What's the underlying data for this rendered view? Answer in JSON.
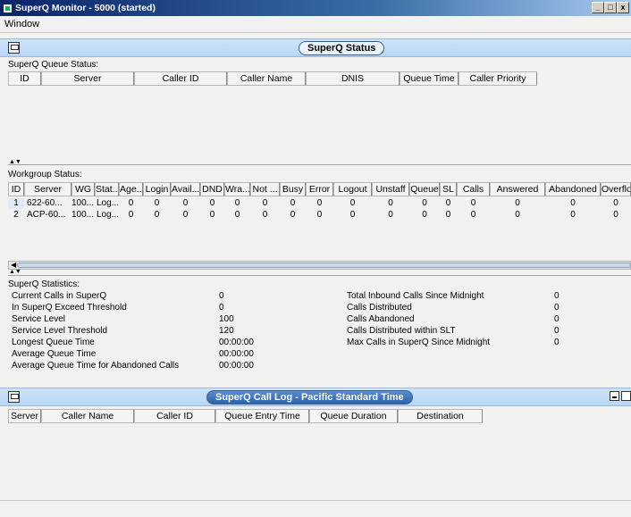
{
  "window": {
    "title": "SuperQ Monitor - 5000 (started)",
    "buttons": {
      "minimize": "_",
      "maximize": "□",
      "close": "x"
    }
  },
  "menu": {
    "items": [
      {
        "label": "Window"
      }
    ]
  },
  "status_panel": {
    "title": "SuperQ Status"
  },
  "queue_status": {
    "label": "SuperQ Queue Status:",
    "columns": [
      "ID",
      "Server",
      "Caller ID",
      "Caller Name",
      "DNIS",
      "Queue Time",
      "Caller Priority"
    ]
  },
  "workgroup_status": {
    "label": "Workgroup Status:",
    "columns": [
      "ID",
      "Server",
      "WG",
      "Stat...",
      "Age...",
      "Login",
      "Avail...",
      "DND",
      "Wra...",
      "Not ...",
      "Busy",
      "Error",
      "Logout",
      "Unstaff",
      "Queue",
      "SL",
      "Calls",
      "Answered",
      "Abandoned",
      "Overflo"
    ],
    "rows": [
      [
        "1",
        "622-60...",
        "100...",
        "Log...",
        "0",
        "0",
        "0",
        "0",
        "0",
        "0",
        "0",
        "0",
        "0",
        "0",
        "0",
        "0",
        "0",
        "0",
        "0",
        "0"
      ],
      [
        "2",
        "ACP-60...",
        "100...",
        "Log...",
        "0",
        "0",
        "0",
        "0",
        "0",
        "0",
        "0",
        "0",
        "0",
        "0",
        "0",
        "0",
        "0",
        "0",
        "0",
        "0"
      ]
    ]
  },
  "statistics": {
    "label": "SuperQ Statistics:",
    "left": [
      {
        "label": "Current Calls in SuperQ",
        "value": "0"
      },
      {
        "label": "In SuperQ Exceed Threshold",
        "value": "0"
      },
      {
        "label": "Service Level",
        "value": "100"
      },
      {
        "label": "Service Level Threshold",
        "value": "120"
      },
      {
        "label": "Longest Queue Time",
        "value": "00:00:00"
      },
      {
        "label": "Average Queue Time",
        "value": "00:00:00"
      },
      {
        "label": "Average Queue Time for Abandoned Calls",
        "value": "00:00:00"
      }
    ],
    "right": [
      {
        "label": "Total Inbound Calls Since Midnight",
        "value": "0"
      },
      {
        "label": "Calls Distributed",
        "value": "0"
      },
      {
        "label": "Calls Abandoned",
        "value": "0"
      },
      {
        "label": "Calls Distributed within SLT",
        "value": "0"
      },
      {
        "label": "Max Calls in SuperQ Since Midnight",
        "value": "0"
      }
    ]
  },
  "call_log": {
    "title": "SuperQ Call Log - Pacific Standard Time",
    "columns": [
      "Server",
      "Caller Name",
      "Caller ID",
      "Queue Entry Time",
      "Queue Duration",
      "Destination"
    ]
  },
  "colors": {
    "title_bar": "#0a246a",
    "panel_header": "#c4ddf7",
    "log_title_fill": "#2d62a8"
  }
}
